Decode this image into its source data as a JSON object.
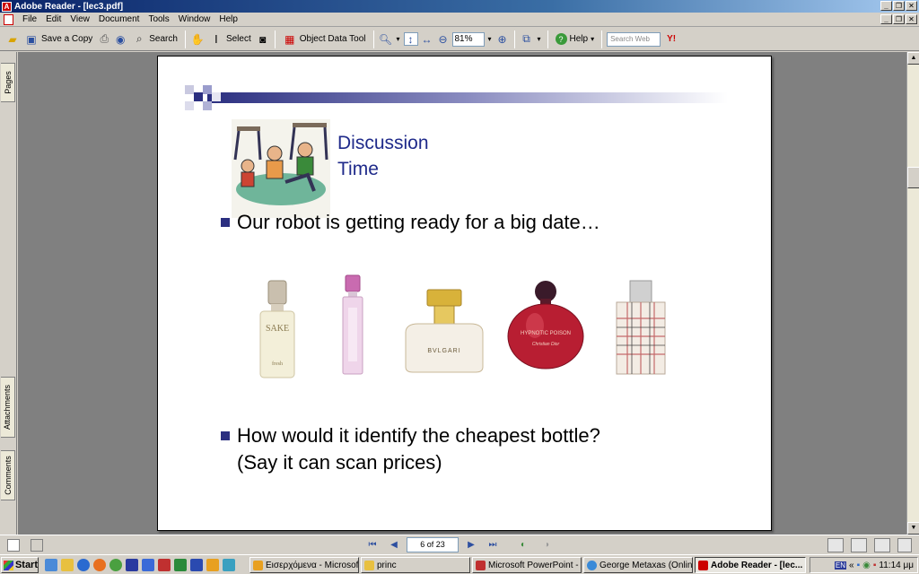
{
  "window": {
    "title": "Adobe Reader - [lec3.pdf]"
  },
  "menu": [
    "File",
    "Edit",
    "View",
    "Document",
    "Tools",
    "Window",
    "Help"
  ],
  "toolbar": {
    "save_copy": "Save a Copy",
    "search": "Search",
    "select": "Select",
    "object_data_tool": "Object Data Tool",
    "zoom": "81%",
    "help": "Help",
    "search_web_placeholder": "Search Web",
    "yahoo_icon": "Y!"
  },
  "side_tabs": {
    "pages": "Pages",
    "attachments": "Attachments",
    "comments": "Comments"
  },
  "slide": {
    "title_line1": "Discussion",
    "title_line2": "Time",
    "bullet1": "Our robot is getting ready for a big date…",
    "bullet2_line1": "How would it identify the cheapest bottle?",
    "bullet2_line2": "(Say it can scan prices)",
    "bottles": [
      {
        "label": "SAKE",
        "sub": "fresh"
      },
      {
        "label": "",
        "sub": ""
      },
      {
        "label": "BVLGARI",
        "sub": ""
      },
      {
        "label": "HYPNOTIC POISON",
        "sub": "Christian Dior"
      },
      {
        "label": "",
        "sub": ""
      }
    ]
  },
  "nav": {
    "page_indicator": "6 of 23"
  },
  "taskbar": {
    "start": "Start",
    "tasks": [
      "Εισερχόμενα - Microsof...",
      "princ",
      "Microsoft PowerPoint - ...",
      "George Metaxas (Onlin...",
      "Adobe Reader - [lec..."
    ],
    "lang": "EN",
    "clock": "11:14 μμ"
  },
  "colors": {
    "title_blue": "#1f2a8a",
    "bullet_blue": "#2b2f80"
  }
}
